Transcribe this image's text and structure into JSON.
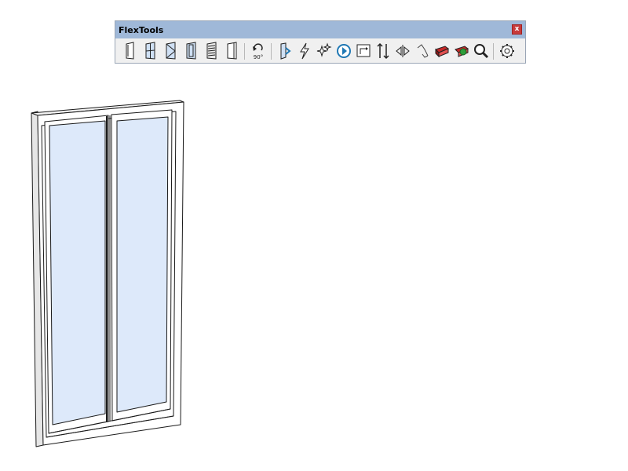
{
  "window": {
    "title": "FlexTools",
    "close_label": "x"
  },
  "tools": [
    {
      "name": "flex-door-icon"
    },
    {
      "name": "flex-window-icon"
    },
    {
      "name": "flex-casement-icon"
    },
    {
      "name": "flex-double-hung-icon"
    },
    {
      "name": "flex-louver-icon"
    },
    {
      "name": "flex-opening-icon"
    },
    {
      "name": "rotate-90-icon",
      "label": "90°"
    },
    {
      "name": "wall-cutter-icon"
    },
    {
      "name": "flash-icon"
    },
    {
      "name": "sparkle-icon"
    },
    {
      "name": "dynamic-refresh-icon"
    },
    {
      "name": "scale-icon"
    },
    {
      "name": "flip-vertical-icon"
    },
    {
      "name": "flip-horizontal-icon"
    },
    {
      "name": "rotate-swing-icon"
    },
    {
      "name": "component-red-icon"
    },
    {
      "name": "component-green-icon"
    },
    {
      "name": "search-icon"
    },
    {
      "name": "gear-icon"
    }
  ],
  "colors": {
    "titlebar": "#9fb8d8",
    "glass": "#dde9fa",
    "frame_edge": "#1a1a1a",
    "accent_blue": "#1f78b4"
  }
}
